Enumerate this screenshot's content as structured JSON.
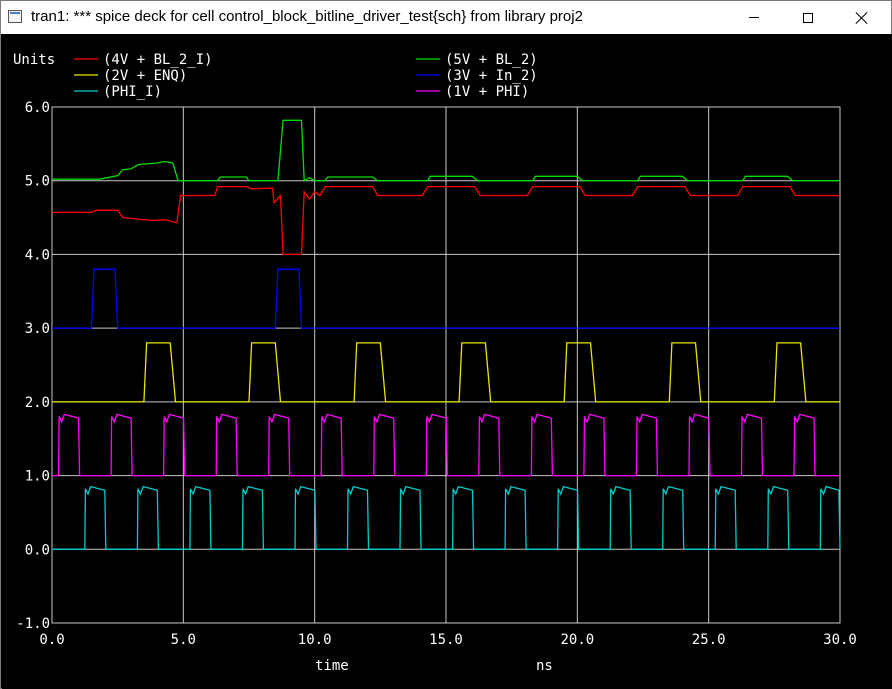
{
  "window": {
    "title": "tran1: *** spice deck for cell control_block_bitline_driver_test{sch} from library proj2",
    "controls": [
      "minimize",
      "maximize",
      "close"
    ]
  },
  "chart_data": {
    "type": "line",
    "ylabel": "Units",
    "xlabel": "time",
    "xunit": "ns",
    "xlim": [
      0,
      30
    ],
    "ylim": [
      -1,
      6
    ],
    "xticks": [
      0,
      5,
      10,
      15,
      20,
      25,
      30
    ],
    "xtick_labels": [
      "0.0",
      "5.0",
      "10.0",
      "15.0",
      "20.0",
      "25.0",
      "30.0"
    ],
    "yticks": [
      -1,
      0,
      1,
      2,
      3,
      4,
      5,
      6
    ],
    "ytick_labels": [
      "-1.0",
      "0.0",
      "1.0",
      "2.0",
      "3.0",
      "4.0",
      "5.0",
      "6.0"
    ],
    "grid": true,
    "legend": "top",
    "background": "#000000",
    "grid_color": "#c8c8c8",
    "series": [
      {
        "name": "(4V + BL_2_I)",
        "color": "#ff0000",
        "points": [
          [
            0,
            4.57
          ],
          [
            1.5,
            4.57
          ],
          [
            1.7,
            4.6
          ],
          [
            2.5,
            4.6
          ],
          [
            2.7,
            4.5
          ],
          [
            3.8,
            4.46
          ],
          [
            4.3,
            4.47
          ],
          [
            4.75,
            4.43
          ],
          [
            4.9,
            4.8
          ],
          [
            6.2,
            4.8
          ],
          [
            6.3,
            4.92
          ],
          [
            7.4,
            4.92
          ],
          [
            7.6,
            4.89
          ],
          [
            8.4,
            4.9
          ],
          [
            8.45,
            4.7
          ],
          [
            8.7,
            4.8
          ],
          [
            8.8,
            4.0
          ],
          [
            9.5,
            4.0
          ],
          [
            9.6,
            4.85
          ],
          [
            9.8,
            4.75
          ],
          [
            10.0,
            4.85
          ],
          [
            10.2,
            4.8
          ],
          [
            10.4,
            4.92
          ],
          [
            12.2,
            4.92
          ],
          [
            12.4,
            4.8
          ],
          [
            14.1,
            4.8
          ],
          [
            14.3,
            4.92
          ],
          [
            16.1,
            4.92
          ],
          [
            16.3,
            4.8
          ],
          [
            18.1,
            4.8
          ],
          [
            18.3,
            4.92
          ],
          [
            20.1,
            4.92
          ],
          [
            20.3,
            4.8
          ],
          [
            22.1,
            4.8
          ],
          [
            22.3,
            4.92
          ],
          [
            24.1,
            4.92
          ],
          [
            24.3,
            4.8
          ],
          [
            26.1,
            4.8
          ],
          [
            26.3,
            4.92
          ],
          [
            28.1,
            4.92
          ],
          [
            28.3,
            4.8
          ],
          [
            30,
            4.8
          ]
        ]
      },
      {
        "name": "(5V + BL_2)",
        "color": "#00dd00",
        "points": [
          [
            0,
            5.02
          ],
          [
            1.8,
            5.02
          ],
          [
            2.5,
            5.07
          ],
          [
            2.7,
            5.15
          ],
          [
            3.0,
            5.16
          ],
          [
            3.3,
            5.22
          ],
          [
            4.0,
            5.24
          ],
          [
            4.3,
            5.26
          ],
          [
            4.6,
            5.24
          ],
          [
            4.8,
            5.0
          ],
          [
            6.3,
            5.0
          ],
          [
            6.4,
            5.05
          ],
          [
            7.4,
            5.05
          ],
          [
            7.5,
            5.0
          ],
          [
            8.6,
            5.0
          ],
          [
            8.8,
            5.82
          ],
          [
            9.5,
            5.82
          ],
          [
            9.6,
            5.0
          ],
          [
            9.8,
            5.04
          ],
          [
            10.0,
            5.0
          ],
          [
            10.4,
            5.0
          ],
          [
            10.5,
            5.05
          ],
          [
            12.2,
            5.05
          ],
          [
            12.4,
            5.0
          ],
          [
            14.3,
            5.0
          ],
          [
            14.4,
            5.06
          ],
          [
            16.0,
            5.06
          ],
          [
            16.2,
            5.0
          ],
          [
            18.3,
            5.0
          ],
          [
            18.4,
            5.06
          ],
          [
            20.0,
            5.06
          ],
          [
            20.2,
            5.0
          ],
          [
            22.3,
            5.0
          ],
          [
            22.4,
            5.06
          ],
          [
            24.0,
            5.06
          ],
          [
            24.2,
            5.0
          ],
          [
            26.3,
            5.0
          ],
          [
            26.4,
            5.06
          ],
          [
            28.0,
            5.06
          ],
          [
            28.2,
            5.0
          ],
          [
            30,
            5.0
          ]
        ]
      },
      {
        "name": "(2V + ENQ)",
        "color": "#e6e600",
        "points": [
          [
            0,
            2.0
          ],
          [
            3.5,
            2.0
          ],
          [
            3.6,
            2.8
          ],
          [
            4.5,
            2.8
          ],
          [
            4.7,
            2.0
          ],
          [
            7.5,
            2.0
          ],
          [
            7.6,
            2.8
          ],
          [
            8.5,
            2.8
          ],
          [
            8.7,
            2.0
          ],
          [
            11.5,
            2.0
          ],
          [
            11.6,
            2.8
          ],
          [
            12.5,
            2.8
          ],
          [
            12.7,
            2.0
          ],
          [
            15.5,
            2.0
          ],
          [
            15.6,
            2.8
          ],
          [
            16.5,
            2.8
          ],
          [
            16.7,
            2.0
          ],
          [
            19.5,
            2.0
          ],
          [
            19.6,
            2.8
          ],
          [
            20.5,
            2.8
          ],
          [
            20.7,
            2.0
          ],
          [
            23.5,
            2.0
          ],
          [
            23.6,
            2.8
          ],
          [
            24.5,
            2.8
          ],
          [
            24.7,
            2.0
          ],
          [
            27.5,
            2.0
          ],
          [
            27.6,
            2.8
          ],
          [
            28.5,
            2.8
          ],
          [
            28.7,
            2.0
          ],
          [
            30,
            2.0
          ]
        ]
      },
      {
        "name": "(3V + In_2)",
        "color": "#0000ff",
        "points": [
          [
            0,
            3.0
          ],
          [
            1.5,
            3.0
          ],
          [
            1.6,
            3.8
          ],
          [
            2.4,
            3.8
          ],
          [
            2.5,
            3.0
          ],
          [
            8.5,
            3.0
          ],
          [
            8.6,
            3.8
          ],
          [
            9.4,
            3.8
          ],
          [
            9.5,
            3.0
          ],
          [
            30,
            3.0
          ]
        ]
      },
      {
        "name": "(PHI_I)",
        "color": "#00cccc",
        "pulse": {
          "base": 0.0,
          "high": 0.82,
          "start": 1.25,
          "period": 2.0,
          "width": 0.8
        }
      },
      {
        "name": "(1V + PHI)",
        "color": "#ff00ff",
        "pulse": {
          "base": 1.0,
          "high": 1.8,
          "start": 0.25,
          "period": 2.0,
          "width": 0.8
        }
      }
    ]
  }
}
